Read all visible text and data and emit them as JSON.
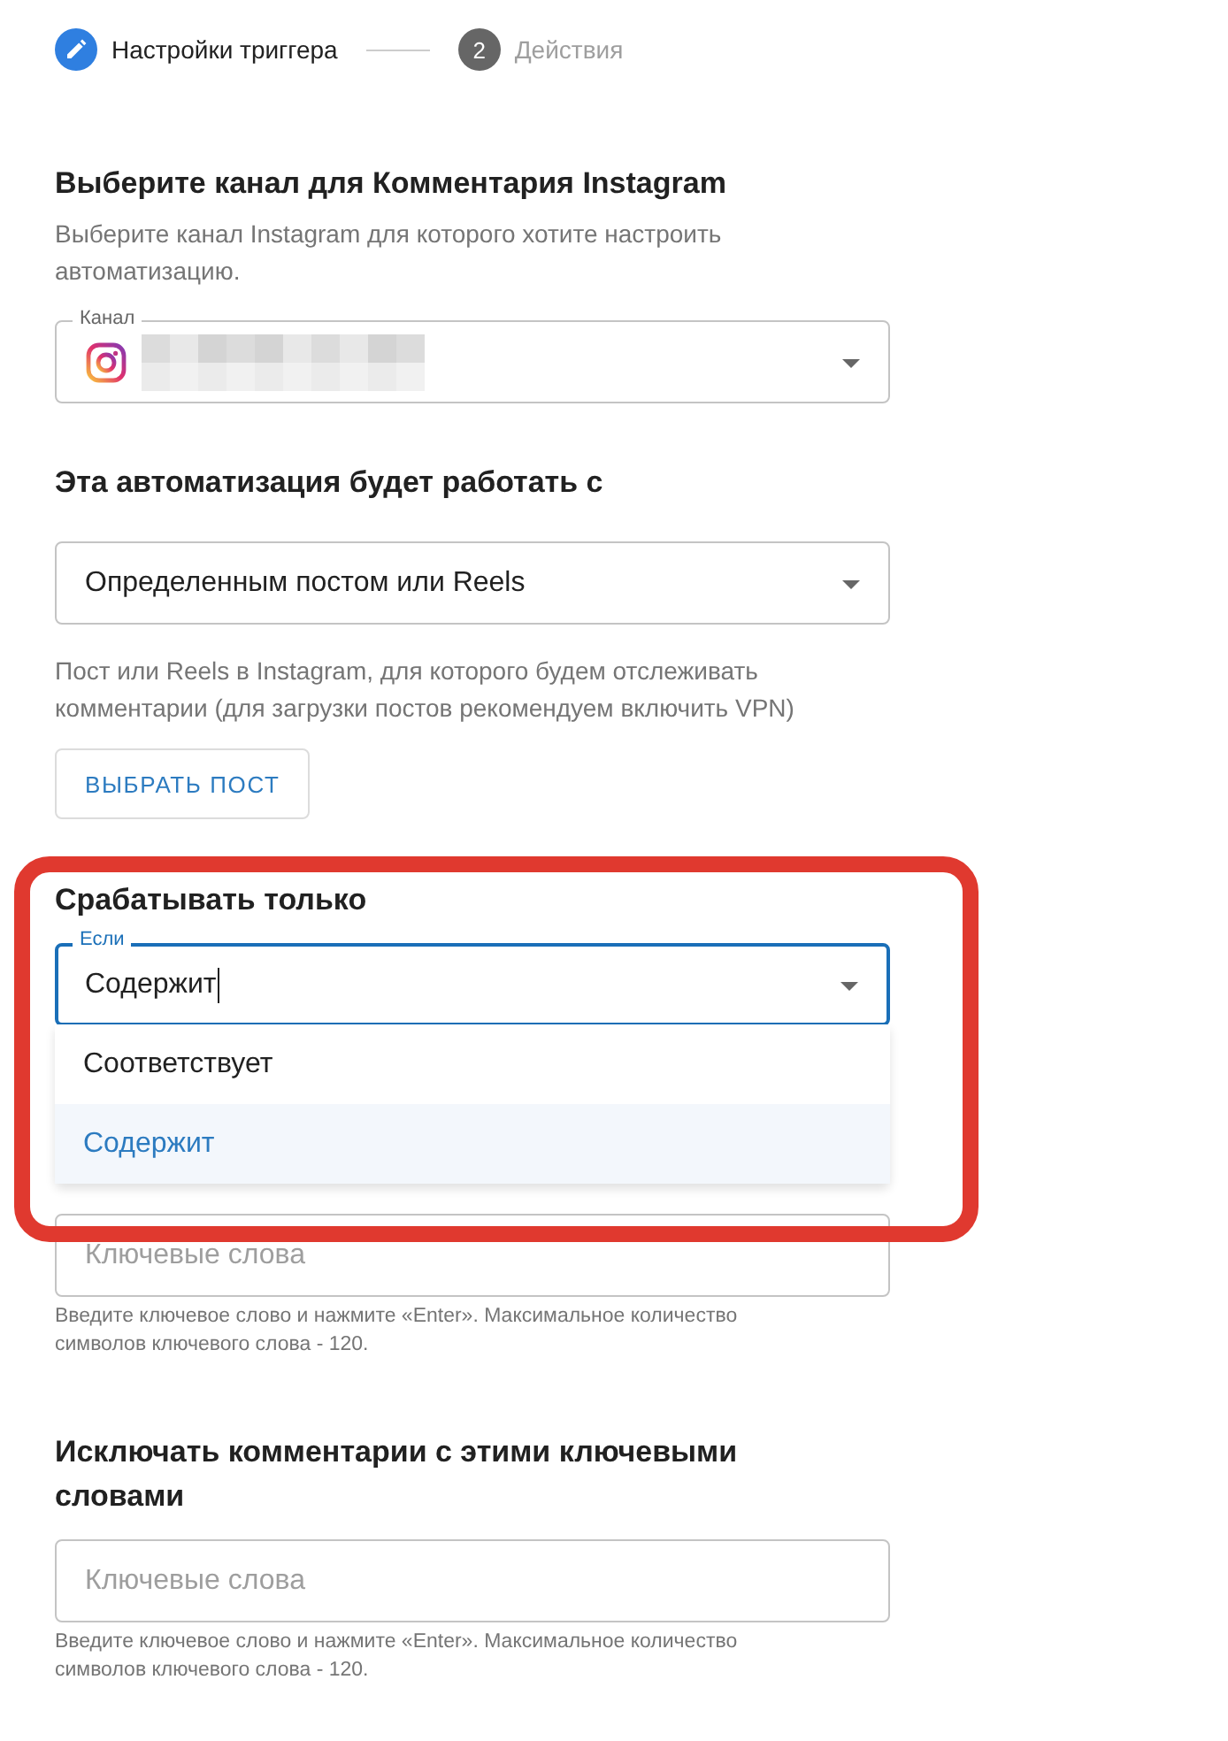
{
  "stepper": [
    {
      "label": "Настройки триггера",
      "active": true
    },
    {
      "number": "2",
      "label": "Действия",
      "active": false
    }
  ],
  "channel_section": {
    "title": "Выберите канал для Комментария Instagram",
    "description": "Выберите канал Instagram для которого хотите настроить автоматизацию.",
    "field": {
      "label": "Канал"
    }
  },
  "target_section": {
    "title": "Эта автоматизация будет работать с",
    "select": {
      "value": "Определенным постом или Reels"
    },
    "helper": "Пост или Reels в Instagram, для которого будем отслеживать комментарии (для загрузки постов рекомендуем включить VPN)",
    "button": "ВЫБРАТЬ ПОСТ"
  },
  "filter_section": {
    "title": "Срабатывать только",
    "select": {
      "label": "Если",
      "value": "Содержит",
      "focused": true
    },
    "menu": [
      {
        "label": "Соответствует",
        "selected": false
      },
      {
        "label": "Содержит",
        "selected": true
      }
    ],
    "keywords": {
      "placeholder": "Ключевые слова"
    },
    "helper": "Введите ключевое слово и нажмите «Enter». Максимальное количество символов ключевого слова - 120."
  },
  "exclude_section": {
    "title": "Исключать комментарии с этими ключевыми словами",
    "keywords": {
      "placeholder": "Ключевые слова"
    },
    "helper": "Введите ключевое слово и нажмите «Enter». Максимальное количество символов ключевого слова - 120."
  }
}
